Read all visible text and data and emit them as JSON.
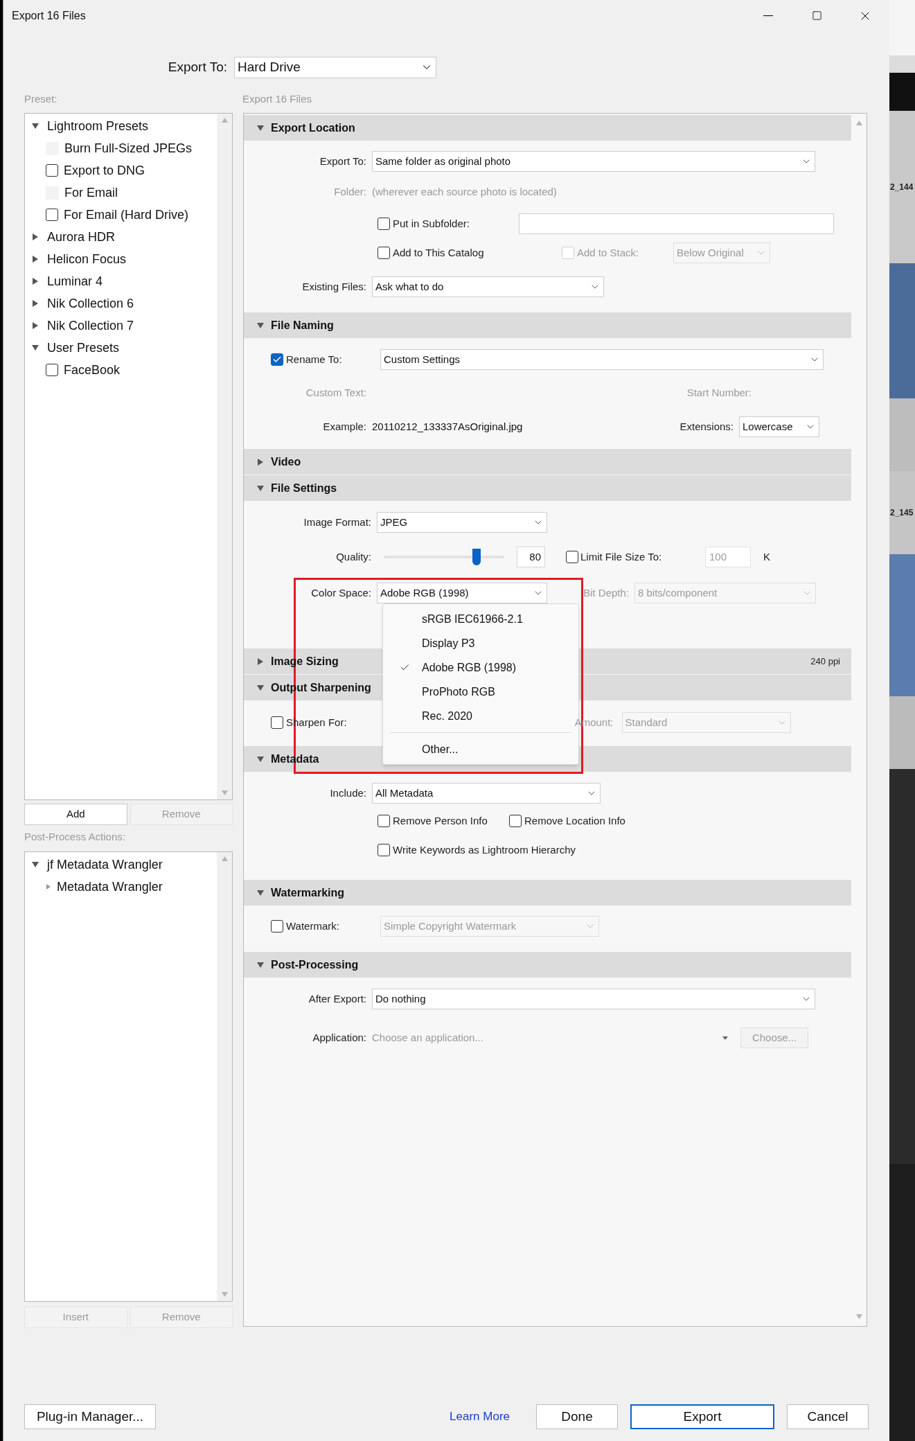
{
  "window": {
    "title": "Export 16 Files"
  },
  "export_to": {
    "label": "Export To:",
    "value": "Hard Drive"
  },
  "preset_panel": {
    "label": "Preset:",
    "tree": [
      {
        "label": "Lightroom Presets",
        "expanded": true,
        "children": [
          {
            "label": "Burn Full-Sized JPEGs",
            "kind": "blank"
          },
          {
            "label": "Export to DNG",
            "kind": "checkbox"
          },
          {
            "label": "For Email",
            "kind": "blank"
          },
          {
            "label": "For Email (Hard Drive)",
            "kind": "checkbox"
          }
        ]
      },
      {
        "label": "Aurora HDR",
        "expanded": false
      },
      {
        "label": "Helicon Focus",
        "expanded": false
      },
      {
        "label": "Luminar 4",
        "expanded": false
      },
      {
        "label": "Nik Collection 6",
        "expanded": false
      },
      {
        "label": "Nik Collection 7",
        "expanded": false
      },
      {
        "label": "User Presets",
        "expanded": true,
        "children": [
          {
            "label": "FaceBook",
            "kind": "checkbox"
          }
        ]
      }
    ],
    "buttons": [
      {
        "label": "Add",
        "disabled": false
      },
      {
        "label": "Remove",
        "disabled": true
      }
    ]
  },
  "post_process_panel": {
    "label": "Post-Process Actions:",
    "tree": [
      {
        "label": "jf Metadata Wrangler",
        "expanded": true,
        "children": [
          {
            "label": "Metadata Wrangler",
            "expanded": false
          }
        ]
      }
    ],
    "buttons": [
      {
        "label": "Insert",
        "disabled": true
      },
      {
        "label": "Remove",
        "disabled": true
      }
    ]
  },
  "settings": {
    "title": "Export 16 Files",
    "export_location": {
      "title": "Export Location",
      "expanded": true,
      "export_to": {
        "label": "Export To:",
        "value": "Same folder as original photo"
      },
      "folder": {
        "label": "Folder:",
        "value": "(wherever each source photo is located)",
        "disabled": true
      },
      "put_in_subfolder": {
        "label": "Put in Subfolder:",
        "checked": false
      },
      "add_to_catalog": {
        "label": "Add to This Catalog",
        "checked": false
      },
      "add_to_stack": {
        "label": "Add to Stack:",
        "checked": false,
        "disabled": true,
        "value": "Below Original"
      },
      "existing_files": {
        "label": "Existing Files:",
        "value": "Ask what to do"
      }
    },
    "file_naming": {
      "title": "File Naming",
      "expanded": true,
      "rename_to": {
        "label": "Rename To:",
        "checked": true,
        "value": "Custom Settings"
      },
      "custom_text": {
        "label": "Custom Text:",
        "disabled": true
      },
      "start_number": {
        "label": "Start Number:",
        "disabled": true
      },
      "example": {
        "label": "Example:",
        "value": "20110212_133337AsOriginal.jpg"
      },
      "extensions": {
        "label": "Extensions:",
        "value": "Lowercase"
      }
    },
    "video": {
      "title": "Video",
      "expanded": false
    },
    "file_settings": {
      "title": "File Settings",
      "expanded": true,
      "image_format": {
        "label": "Image Format:",
        "value": "JPEG"
      },
      "quality": {
        "label": "Quality:",
        "level": 0.77,
        "value": "80"
      },
      "limit_file_size": {
        "label": "Limit File Size To:",
        "checked": false,
        "value": "100",
        "unit": "K",
        "disabled": true
      },
      "color_space": {
        "label": "Color Space:",
        "value": "Adobe RGB (1998)",
        "open": true,
        "options": [
          {
            "label": "sRGB IEC61966-2.1",
            "selected": false
          },
          {
            "label": "Display P3",
            "selected": false
          },
          {
            "label": "Adobe RGB (1998)",
            "selected": true
          },
          {
            "label": "ProPhoto RGB",
            "selected": false
          },
          {
            "label": "Rec. 2020",
            "selected": false
          }
        ],
        "extra_options": [
          {
            "label": "Other...",
            "selected": false
          }
        ]
      },
      "bit_depth": {
        "label": "Bit Depth:",
        "value": "8 bits/component",
        "disabled": true
      }
    },
    "image_sizing": {
      "title": "Image Sizing",
      "expanded": false,
      "summary": "240 ppi"
    },
    "output_sharpening": {
      "title": "Output Sharpening",
      "expanded": true,
      "sharpen_for": {
        "label": "Sharpen For:",
        "checked": false
      },
      "amount": {
        "label": "Amount:",
        "value": "Standard",
        "disabled": true
      }
    },
    "metadata": {
      "title": "Metadata",
      "expanded": true,
      "include": {
        "label": "Include:",
        "value": "All Metadata"
      },
      "remove_person_info": {
        "label": "Remove Person Info",
        "checked": false
      },
      "remove_location_info": {
        "label": "Remove Location Info",
        "checked": false
      },
      "write_keywords": {
        "label": "Write Keywords as Lightroom Hierarchy",
        "checked": false
      }
    },
    "watermarking": {
      "title": "Watermarking",
      "expanded": true,
      "watermark": {
        "label": "Watermark:",
        "checked": false,
        "value": "Simple Copyright Watermark",
        "disabled": true
      }
    },
    "post_processing": {
      "title": "Post-Processing",
      "expanded": true,
      "after_export": {
        "label": "After Export:",
        "value": "Do nothing"
      },
      "application": {
        "label": "Application:",
        "placeholder": "Choose an application...",
        "button": "Choose...",
        "disabled": true
      }
    }
  },
  "footer": {
    "plugin_manager": "Plug-in Manager...",
    "learn_more": "Learn More",
    "buttons": [
      {
        "label": "Done",
        "default": false
      },
      {
        "label": "Export",
        "default": true
      },
      {
        "label": "Cancel",
        "default": false
      }
    ]
  },
  "background_app": {
    "labels": [
      "2_144",
      "2_145"
    ]
  }
}
